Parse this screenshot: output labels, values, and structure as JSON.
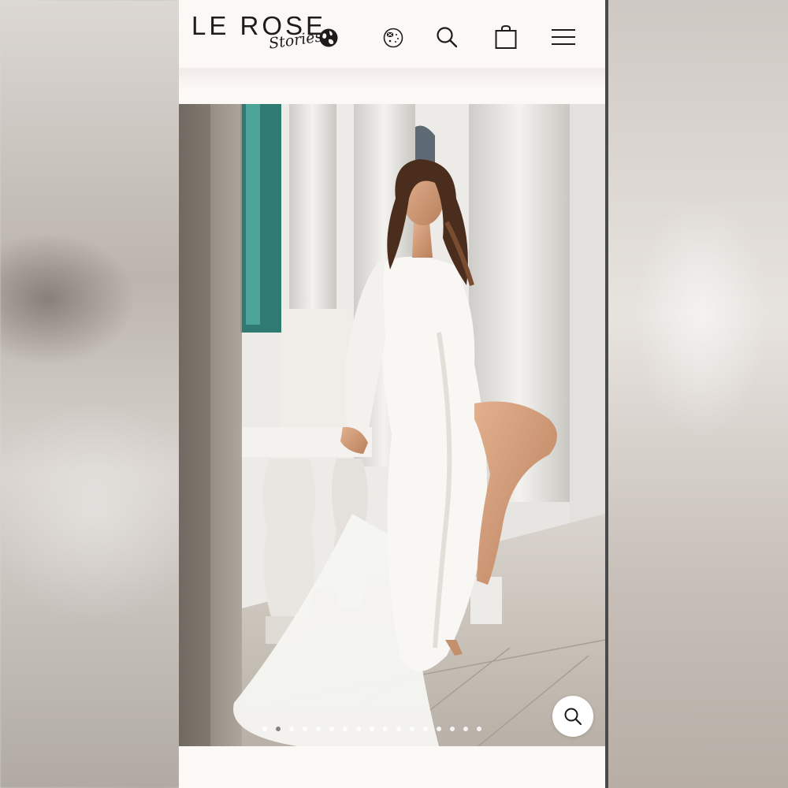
{
  "header": {
    "logo_main": "LE ROSE",
    "logo_script": "Stories"
  },
  "icons": {
    "globe": "globe-icon",
    "flag": "australia-flag-icon",
    "search": "search-icon",
    "bag": "shopping-bag-icon",
    "menu": "menu-icon",
    "zoom": "zoom-search-icon"
  },
  "gallery": {
    "total_slides": 17,
    "active_index": 1
  },
  "colors": {
    "page_bg": "#fcf8f6",
    "text": "#1c1c1c"
  }
}
